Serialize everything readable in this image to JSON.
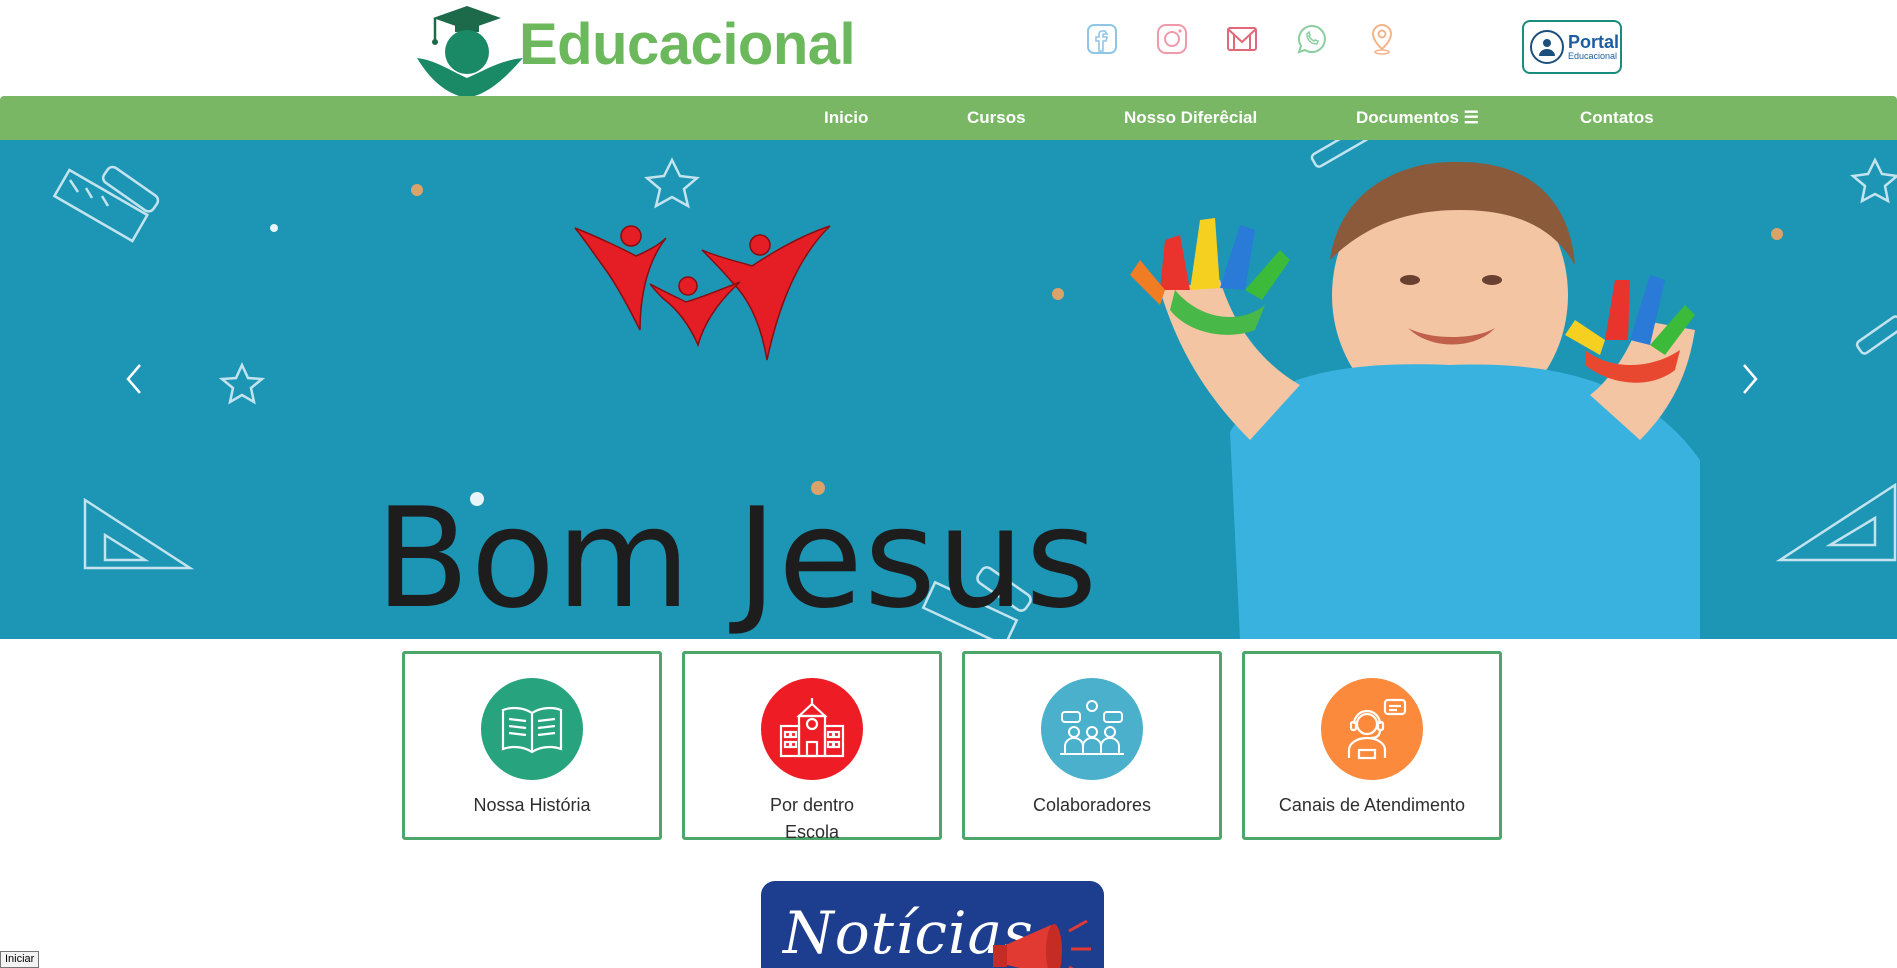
{
  "header": {
    "brand": "Educacional",
    "social_icons": [
      "facebook-icon",
      "instagram-icon",
      "email-icon",
      "whatsapp-icon",
      "location-pin-icon"
    ],
    "portal": {
      "title": "Portal",
      "subtitle": "Educacional"
    }
  },
  "nav": {
    "items": [
      {
        "label": "Inicio"
      },
      {
        "label": "Cursos"
      },
      {
        "label": "Nosso Diferêcial"
      },
      {
        "label": "Documentos ☰"
      },
      {
        "label": "Contatos"
      }
    ]
  },
  "hero": {
    "text": "Bom Jesus",
    "prev_icon": "chevron-left-icon",
    "next_icon": "chevron-right-icon"
  },
  "cards": [
    {
      "label": "Nossa História",
      "icon": "book-icon",
      "color": "#27a37d"
    },
    {
      "label": "Por dentro Escola",
      "icon": "school-building-icon",
      "color": "#ee1c24"
    },
    {
      "label": "Colaboradores",
      "icon": "team-icon",
      "color": "#4bb0cc"
    },
    {
      "label": "Canais de Atendimento",
      "icon": "support-agent-icon",
      "color": "#fb8a3c"
    }
  ],
  "news": {
    "title": "Notícias"
  },
  "taskbar": {
    "label": "Iniciar"
  },
  "colors": {
    "brand_green": "#6cb85c",
    "nav_green": "#79b765",
    "hero_blue": "#1d95b5",
    "card_border": "#4da76b"
  }
}
